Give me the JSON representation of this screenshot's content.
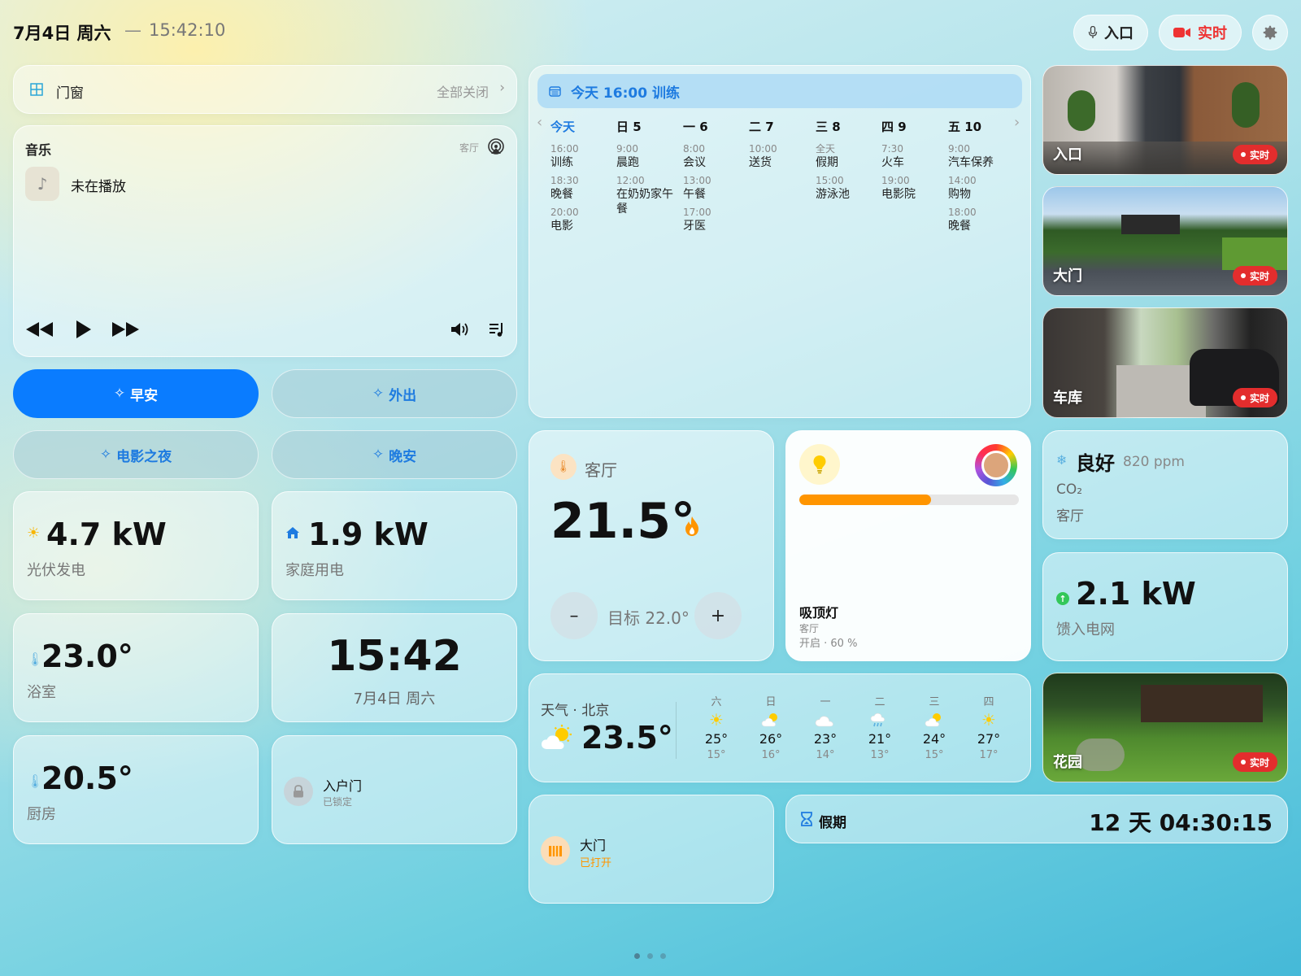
{
  "header": {
    "date": "7月4日 周六",
    "separator": "—",
    "time": "15:42:10",
    "entrance_button": "入口",
    "live_button": "实时"
  },
  "doors_windows": {
    "title": "门窗",
    "action": "全部关闭"
  },
  "music": {
    "title": "音乐",
    "room": "客厅",
    "status": "未在播放"
  },
  "scenes": [
    {
      "label": "早安",
      "active": true
    },
    {
      "label": "外出",
      "active": false
    },
    {
      "label": "电影之夜",
      "active": false
    },
    {
      "label": "晚安",
      "active": false
    }
  ],
  "stats": {
    "solar": {
      "value": "4.7 kW",
      "label": "光伏发电"
    },
    "home_power": {
      "value": "1.9 kW",
      "label": "家庭用电"
    },
    "bathroom": {
      "value": "23.0°",
      "label": "浴室"
    },
    "clock": {
      "time": "15:42",
      "date": "7月4日 周六"
    },
    "kitchen": {
      "value": "20.5°",
      "label": "厨房"
    },
    "front_door": {
      "title": "入户门",
      "status": "已锁定"
    }
  },
  "calendar": {
    "banner": "今天 16:00 训练",
    "days": [
      {
        "head": "今天",
        "today": true,
        "events": [
          {
            "time": "16:00",
            "title": "训练"
          },
          {
            "time": "18:30",
            "title": "晚餐"
          },
          {
            "time": "20:00",
            "title": "电影"
          }
        ]
      },
      {
        "head": "日 5",
        "events": [
          {
            "time": "9:00",
            "title": "晨跑"
          },
          {
            "time": "12:00",
            "title": "在奶奶家午餐"
          }
        ]
      },
      {
        "head": "一 6",
        "events": [
          {
            "time": "8:00",
            "title": "会议"
          },
          {
            "time": "13:00",
            "title": "午餐"
          },
          {
            "time": "17:00",
            "title": "牙医"
          }
        ]
      },
      {
        "head": "二 7",
        "events": [
          {
            "time": "10:00",
            "title": "送货"
          }
        ]
      },
      {
        "head": "三 8",
        "events": [
          {
            "time": "全天",
            "title": "假期"
          },
          {
            "time": "15:00",
            "title": "游泳池"
          }
        ]
      },
      {
        "head": "四 9",
        "events": [
          {
            "time": "7:30",
            "title": "火车"
          },
          {
            "time": "19:00",
            "title": "电影院"
          }
        ]
      },
      {
        "head": "五 10",
        "events": [
          {
            "time": "9:00",
            "title": "汽车保养"
          },
          {
            "time": "14:00",
            "title": "购物"
          },
          {
            "time": "18:00",
            "title": "晚餐"
          }
        ]
      }
    ]
  },
  "cameras": [
    {
      "name": "入口",
      "live": "实时"
    },
    {
      "name": "大门",
      "live": "实时"
    },
    {
      "name": "车库",
      "live": "实时"
    },
    {
      "name": "花园",
      "live": "实时"
    }
  ],
  "thermostat": {
    "room": "客厅",
    "temp": "21.5°",
    "target": "目标 22.0°",
    "minus": "–",
    "plus": "+"
  },
  "light": {
    "name": "吸顶灯",
    "room": "客厅",
    "status": "开启 · 60 %",
    "brightness": 0.6,
    "bar_color": "#ff9500"
  },
  "co2": {
    "quality": "良好",
    "ppm": "820 ppm",
    "label": "CO₂",
    "room": "客厅"
  },
  "grid": {
    "value": "2.1 kW",
    "label": "馈入电网"
  },
  "weather": {
    "title": "天气 · 北京",
    "temp": "23.5°",
    "forecast": [
      {
        "day": "六",
        "icon": "sun-icon",
        "hi": "25°",
        "lo": "15°"
      },
      {
        "day": "日",
        "icon": "partly-cloudy-icon",
        "hi": "26°",
        "lo": "16°"
      },
      {
        "day": "一",
        "icon": "cloud-icon",
        "hi": "23°",
        "lo": "14°"
      },
      {
        "day": "二",
        "icon": "rain-icon",
        "hi": "21°",
        "lo": "13°"
      },
      {
        "day": "三",
        "icon": "partly-cloudy-icon",
        "hi": "24°",
        "lo": "15°"
      },
      {
        "day": "四",
        "icon": "sun-icon",
        "hi": "27°",
        "lo": "17°"
      }
    ]
  },
  "gate": {
    "title": "大门",
    "status": "已打开"
  },
  "countdown": {
    "title": "假期",
    "value": "12 天 04:30:15"
  },
  "colors": {
    "accent": "#0a7cff",
    "live_red": "#e32d2d",
    "orange": "#ff9500"
  }
}
